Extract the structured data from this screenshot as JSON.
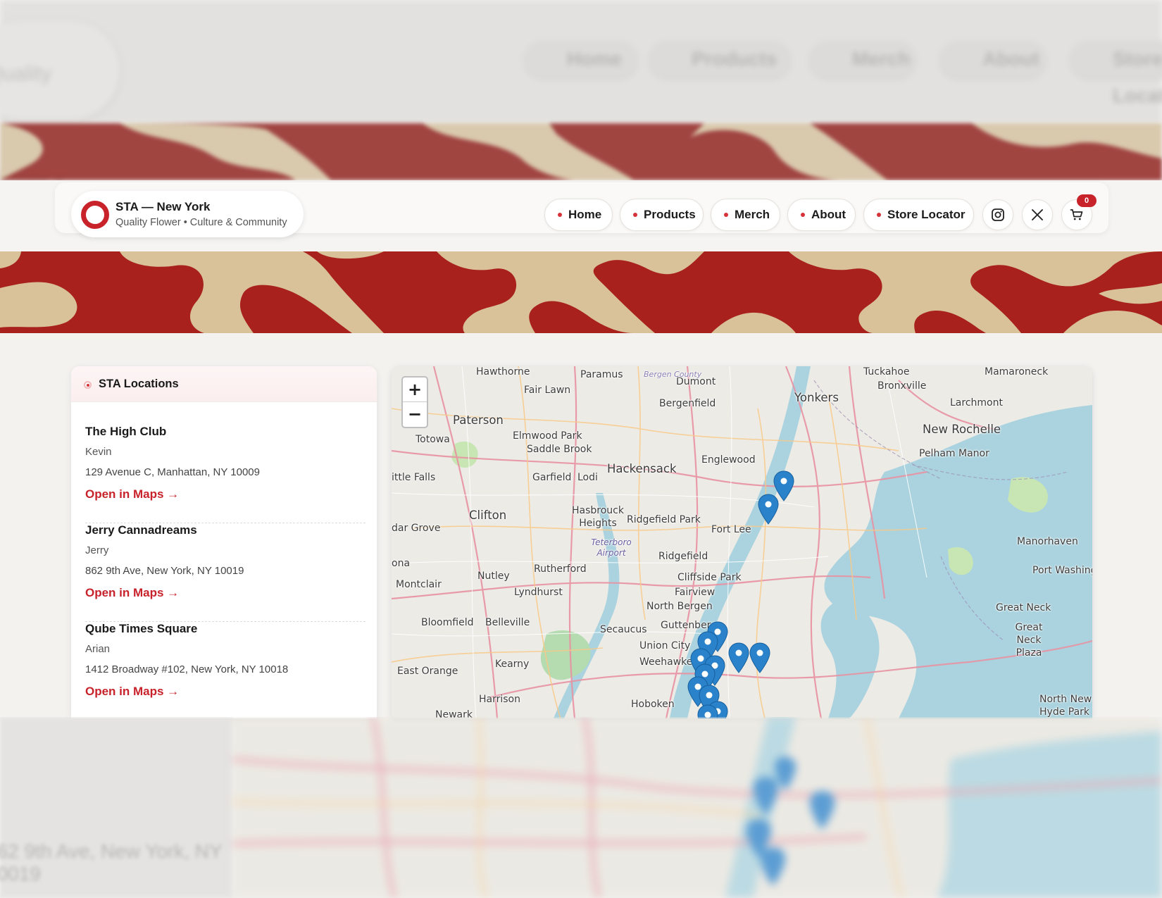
{
  "brand": {
    "name": "STA — New York",
    "tagline": "Quality Flower • Culture & Community"
  },
  "nav": {
    "items": [
      {
        "label": "Home"
      },
      {
        "label": "Products"
      },
      {
        "label": "Merch"
      },
      {
        "label": "About"
      },
      {
        "label": "Store Locator"
      }
    ],
    "icons": [
      "instagram-icon",
      "x-icon",
      "cart-icon"
    ],
    "cart_count": "0"
  },
  "colors": {
    "accent": "#c8222b",
    "pattern_red": "#a8211d",
    "pattern_tan": "#d9c29a",
    "page_bg": "#f4f2ef",
    "marker_blue": "#2a82cb"
  },
  "locations": {
    "title": "STA Locations",
    "items": [
      {
        "name": "The High Club",
        "contact": "Kevin",
        "address": "129 Avenue C, Manhattan, NY 10009",
        "link": "Open in Maps →"
      },
      {
        "name": "Jerry Cannadreams",
        "contact": "Jerry",
        "address": "862 9th Ave, New York, NY 10019",
        "link": "Open in Maps →"
      },
      {
        "name": "Qube Times Square",
        "contact": "Arian",
        "address": "1412 Broadway #102, New York, NY 10018",
        "link": "Open in Maps →"
      }
    ]
  },
  "map": {
    "zoom_in": "+",
    "zoom_out": "−",
    "places": [
      "Hawthorne",
      "Paramus",
      "Dumont",
      "Bergenfield",
      "Yonkers",
      "Tuckahoe",
      "Bronxville",
      "Mamaroneck",
      "Larchmont",
      "New Rochelle",
      "Pelham Manor",
      "Fair Lawn",
      "Paterson",
      "Totowa",
      "Elmwood Park",
      "Saddle Brook",
      "Hackensack",
      "Englewood",
      "Garfield",
      "Lodi",
      "ittle Falls",
      "Clifton",
      "Hasbrouck Heights",
      "Ridgefield Park",
      "Fort Lee",
      "dar Grove",
      "Teterboro Airport",
      "Ridgefield",
      "Cliffside Park",
      "Fairview",
      "North Bergen",
      "Nutley",
      "Rutherford",
      "Lyndhurst",
      "Montclair",
      "ona",
      "Bloomfield",
      "Belleville",
      "Secaucus",
      "Guttenberg",
      "Union City",
      "Weehawken",
      "Kearny",
      "East Orange",
      "Harrison",
      "Hoboken",
      "Newark",
      "Manorhaven",
      "Port Washing",
      "Great Neck",
      "Great Neck Plaza",
      "North New Hyde Park",
      "Bergen County"
    ]
  }
}
